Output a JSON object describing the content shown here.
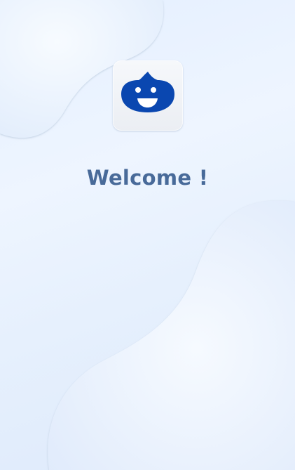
{
  "app": {
    "logo_icon": "smiling-blob-icon",
    "logo_color": "#0a47b0"
  },
  "welcome": {
    "title": "Welcome !"
  },
  "colors": {
    "title": "#486a99",
    "background": "#e6f0fd"
  }
}
